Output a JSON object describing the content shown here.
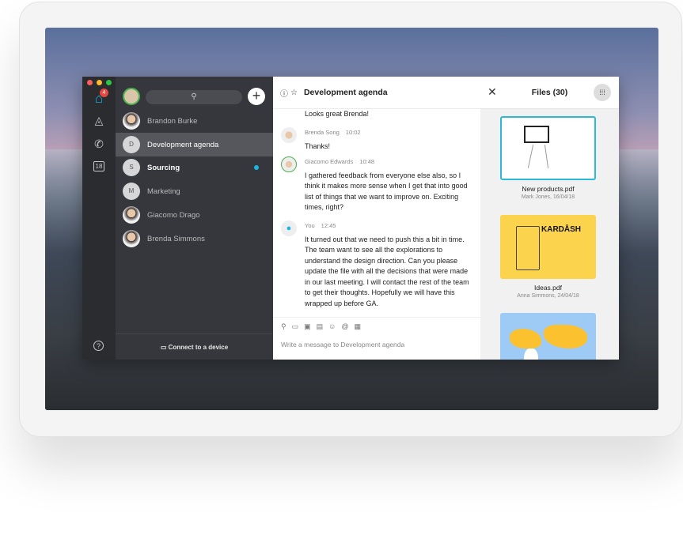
{
  "rail": {
    "home_badge": "4",
    "calendar_day": "18",
    "icons": [
      "home-icon",
      "teams-icon",
      "phone-icon",
      "calendar-icon",
      "help-icon"
    ]
  },
  "list": {
    "items": [
      {
        "label": "Brandon Burke",
        "avatar": ""
      },
      {
        "label": "Development agenda",
        "avatar": "D",
        "selected": true
      },
      {
        "label": "Sourcing",
        "avatar": "S",
        "unread": true
      },
      {
        "label": "Marketing",
        "avatar": "M"
      },
      {
        "label": "Giacomo Drago",
        "avatar": ""
      },
      {
        "label": "Brenda Simmons",
        "avatar": ""
      }
    ],
    "connect": "Connect to a device"
  },
  "chat": {
    "title": "Development agenda",
    "messages": [
      {
        "author": "",
        "time": "",
        "text": "Looks great Brenda!"
      },
      {
        "author": "Brenda Song",
        "time": "10:02",
        "text": "Thanks!"
      },
      {
        "author": "Giacomo Edwards",
        "time": "10:48",
        "text": "I gathered feedback from everyone else also, so I think it makes more sense when I get that into good list of things that we want to improve on. Exciting times, right?"
      },
      {
        "author": "You",
        "time": "12:45",
        "text": "It turned out that we need to push this a bit in time. The team want to see all the explorations to understand the design direction. Can you please update the file with all the decisions that were made in our last meeting. I will contact the rest of the team to get their thoughts. Hopefully we will have this wrapped up before GA."
      }
    ],
    "placeholder": "Write a message to Development agenda"
  },
  "files": {
    "title": "Files (30)",
    "items": [
      {
        "name": "New products.pdf",
        "meta": "Mark Jones, 16/04/18"
      },
      {
        "name": "Ideas.pdf",
        "meta": "Anna Simmons, 24/04/18",
        "brand": "KARDÅSH"
      },
      {
        "name": "",
        "meta": ""
      }
    ]
  },
  "colors": {
    "accent": "#16b8e8",
    "badge": "#e5483f",
    "thumb_yellow": "#fcd34d",
    "map_blue": "#9ecbf5"
  }
}
